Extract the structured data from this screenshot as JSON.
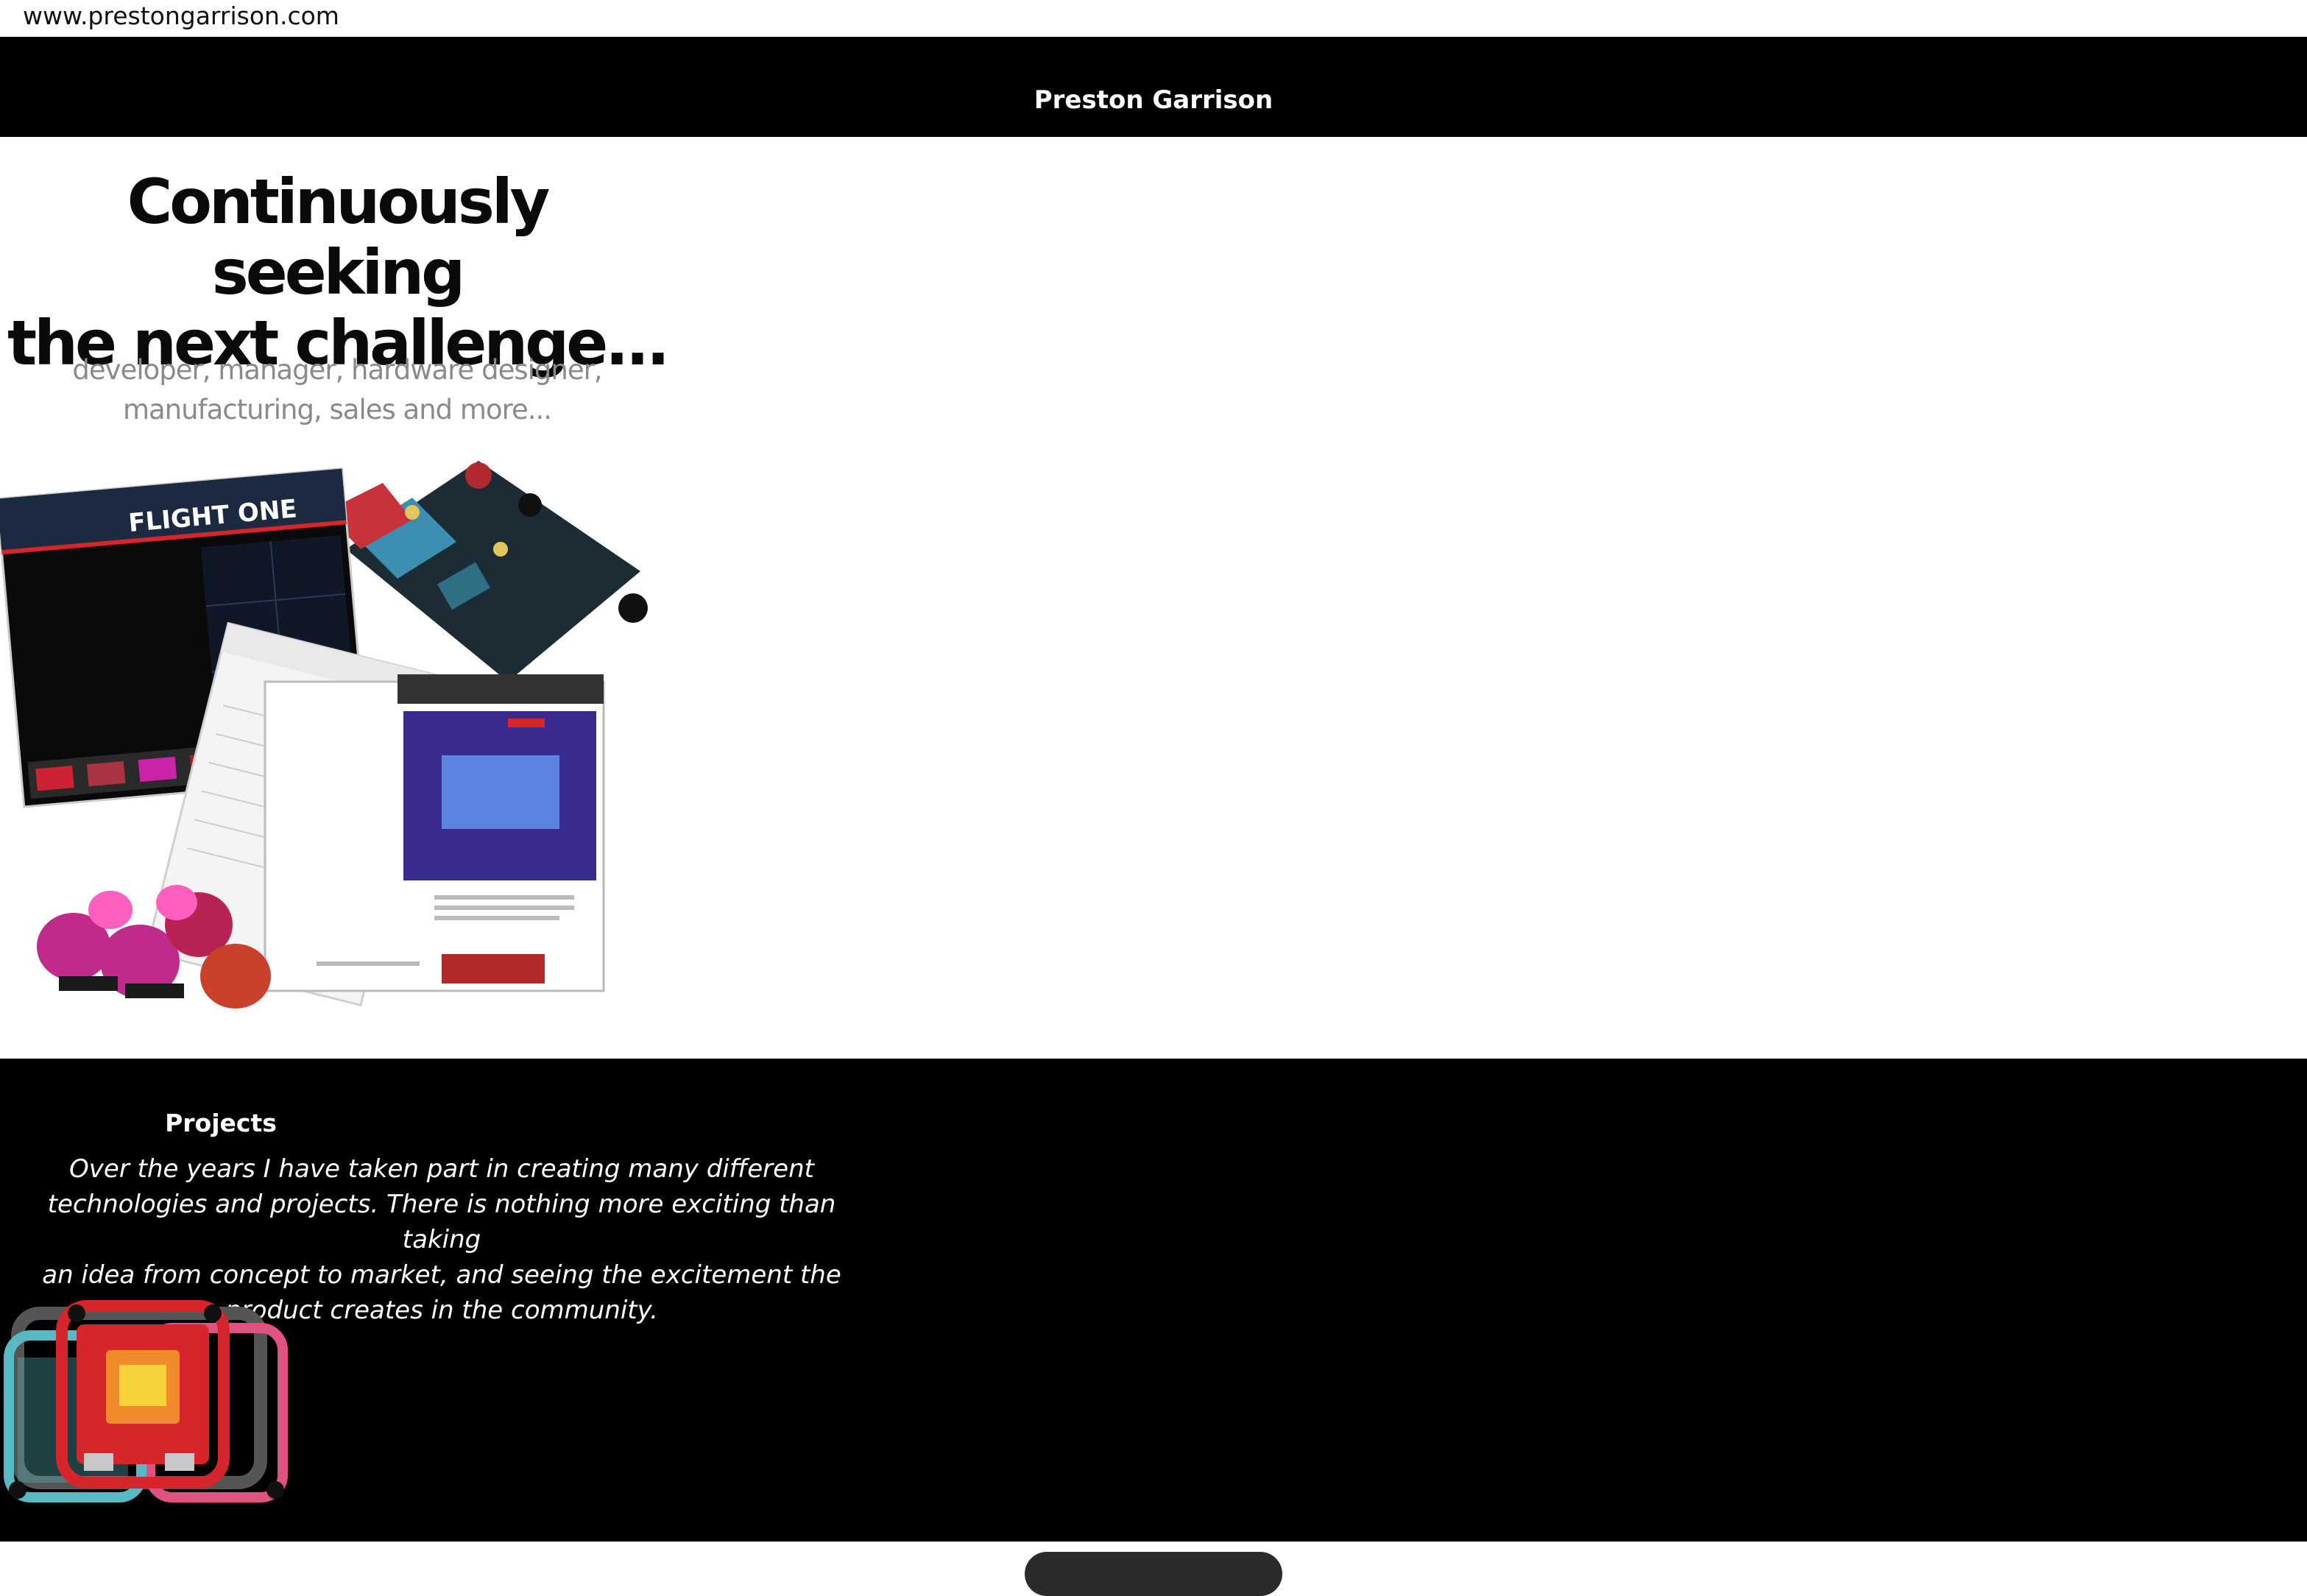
{
  "browser": {
    "url": "www.prestongarrison.com"
  },
  "header": {
    "brand": "Preston Garrison"
  },
  "hero": {
    "title_line1": "Continuously seeking",
    "title_line2": "the next challenge...",
    "subtitle_line1": "developer, manager, hardware designer,",
    "subtitle_line2": "manufacturing, sales and more...",
    "collage": {
      "screen_logo": "FLIGHT ONE"
    }
  },
  "projects": {
    "title": "Projects",
    "body_line1": "Over the years I have taken part in creating many different",
    "body_line2": "technologies and projects. There is nothing more exciting than taking",
    "body_line3": "an idea from concept to market, and seeing the excitement the",
    "body_line4": "product creates in the community."
  },
  "colors": {
    "header_bg": "#000000",
    "projects_bg": "#000000",
    "subtitle": "#8a8a8a",
    "accent_red": "#d7262b",
    "accent_teal": "#56b9c4",
    "accent_pink": "#e0527f"
  }
}
